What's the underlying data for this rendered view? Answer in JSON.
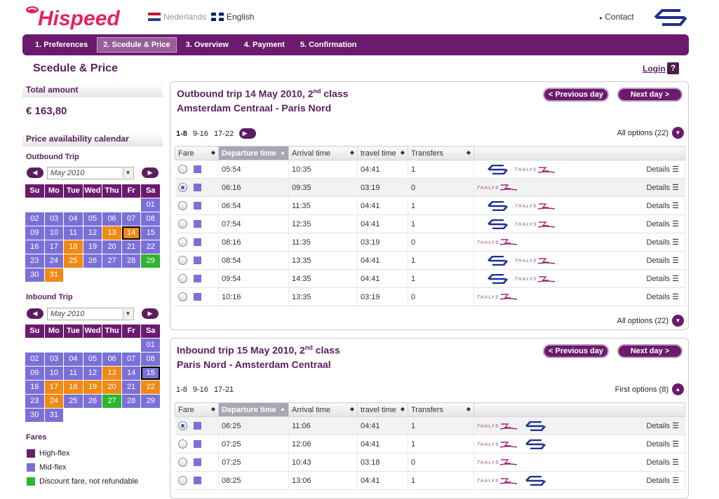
{
  "brand": "Hispeed",
  "languages": [
    {
      "label": "Nederlands",
      "active": false
    },
    {
      "label": "English",
      "active": true
    }
  ],
  "contact": "Contact",
  "steps": [
    "1. Preferences",
    "2. Scedule & Price",
    "3. Overview",
    "4. Payment",
    "5. Confirmation"
  ],
  "page_title": "Scedule & Price",
  "login": "Login",
  "help": "?",
  "sidebar": {
    "total_label": "Total amount",
    "total_value": "€ 163,80",
    "calendar_heading": "Price availability calendar",
    "outbound": {
      "title": "Outbound Trip",
      "month": "May 2010"
    },
    "inbound": {
      "title": "Inbound Trip",
      "month": "May 2010"
    },
    "weekdays": [
      "Su",
      "Mo",
      "Tue",
      "Wed",
      "Thu",
      "Fr",
      "Sa"
    ],
    "fares_title": "Fares",
    "fares_legend": [
      {
        "label": "High-flex",
        "color": "#6b1a6e"
      },
      {
        "label": "Mid-flex",
        "color": "#7b70d8"
      },
      {
        "label": "Discount fare, not refundable",
        "color": "#2db52d"
      }
    ]
  },
  "outbound_calendar": [
    [
      null,
      null,
      null,
      null,
      null,
      null,
      {
        "d": "01",
        "c": "m"
      }
    ],
    [
      {
        "d": "02",
        "c": "m"
      },
      {
        "d": "03",
        "c": "m"
      },
      {
        "d": "04",
        "c": "m"
      },
      {
        "d": "05",
        "c": "m"
      },
      {
        "d": "06",
        "c": "m"
      },
      {
        "d": "07",
        "c": "m"
      },
      {
        "d": "08",
        "c": "m"
      }
    ],
    [
      {
        "d": "09",
        "c": "m"
      },
      {
        "d": "10",
        "c": "m"
      },
      {
        "d": "11",
        "c": "m"
      },
      {
        "d": "12",
        "c": "m"
      },
      {
        "d": "13",
        "c": "o"
      },
      {
        "d": "14",
        "c": "o",
        "sel": true
      },
      {
        "d": "15",
        "c": "m"
      }
    ],
    [
      {
        "d": "16",
        "c": "m"
      },
      {
        "d": "17",
        "c": "m"
      },
      {
        "d": "18",
        "c": "o"
      },
      {
        "d": "19",
        "c": "m"
      },
      {
        "d": "20",
        "c": "m"
      },
      {
        "d": "21",
        "c": "m"
      },
      {
        "d": "22",
        "c": "m"
      }
    ],
    [
      {
        "d": "23",
        "c": "m"
      },
      {
        "d": "24",
        "c": "m"
      },
      {
        "d": "25",
        "c": "o"
      },
      {
        "d": "26",
        "c": "m"
      },
      {
        "d": "27",
        "c": "m"
      },
      {
        "d": "28",
        "c": "m"
      },
      {
        "d": "29",
        "c": "g"
      }
    ],
    [
      {
        "d": "30",
        "c": "m"
      },
      {
        "d": "31",
        "c": "o"
      },
      null,
      null,
      null,
      null,
      null
    ]
  ],
  "inbound_calendar": [
    [
      null,
      null,
      null,
      null,
      null,
      null,
      {
        "d": "01",
        "c": "m"
      }
    ],
    [
      {
        "d": "02",
        "c": "m"
      },
      {
        "d": "03",
        "c": "m"
      },
      {
        "d": "04",
        "c": "m"
      },
      {
        "d": "05",
        "c": "m"
      },
      {
        "d": "06",
        "c": "m"
      },
      {
        "d": "07",
        "c": "m"
      },
      {
        "d": "08",
        "c": "m"
      }
    ],
    [
      {
        "d": "09",
        "c": "m"
      },
      {
        "d": "10",
        "c": "m"
      },
      {
        "d": "11",
        "c": "m"
      },
      {
        "d": "12",
        "c": "m"
      },
      {
        "d": "13",
        "c": "o"
      },
      {
        "d": "14",
        "c": "m"
      },
      {
        "d": "15",
        "c": "m",
        "sel": true
      }
    ],
    [
      {
        "d": "16",
        "c": "m"
      },
      {
        "d": "17",
        "c": "o"
      },
      {
        "d": "18",
        "c": "o"
      },
      {
        "d": "19",
        "c": "o"
      },
      {
        "d": "20",
        "c": "o"
      },
      {
        "d": "21",
        "c": "m"
      },
      {
        "d": "22",
        "c": "o"
      }
    ],
    [
      {
        "d": "23",
        "c": "m"
      },
      {
        "d": "24",
        "c": "o"
      },
      {
        "d": "25",
        "c": "m"
      },
      {
        "d": "26",
        "c": "m"
      },
      {
        "d": "27",
        "c": "g"
      },
      {
        "d": "28",
        "c": "m"
      },
      {
        "d": "29",
        "c": "m"
      }
    ],
    [
      {
        "d": "30",
        "c": "m"
      },
      {
        "d": "31",
        "c": "m"
      },
      null,
      null,
      null,
      null,
      null
    ]
  ],
  "outbound": {
    "title_pre": "Outbound trip 14 May 2010, 2",
    "title_sup": "nd",
    "title_post": " class",
    "route": "Amsterdam Centraal - Paris Nord",
    "prev": "< Previous day",
    "next": "Next day >",
    "pages": [
      "1-8",
      "9-16",
      "17-22"
    ],
    "options_top": "All options (22)",
    "options_bottom": "All options (22)",
    "columns": [
      "Fare",
      "Departure time",
      "Arrival time",
      "travel time",
      "Transfers"
    ],
    "details_label": "Details",
    "rows": [
      {
        "dep": "05:54",
        "arr": "10:35",
        "travel": "04:41",
        "transfers": "1",
        "ops": [
          "ns",
          "thalys"
        ],
        "selected": false
      },
      {
        "dep": "06:16",
        "arr": "09:35",
        "travel": "03:19",
        "transfers": "0",
        "ops": [
          "thalys"
        ],
        "selected": true
      },
      {
        "dep": "06:54",
        "arr": "11:35",
        "travel": "04:41",
        "transfers": "1",
        "ops": [
          "ns",
          "thalys"
        ],
        "selected": false
      },
      {
        "dep": "07:54",
        "arr": "12:35",
        "travel": "04:41",
        "transfers": "1",
        "ops": [
          "ns",
          "thalys"
        ],
        "selected": false
      },
      {
        "dep": "08:16",
        "arr": "11:35",
        "travel": "03:19",
        "transfers": "0",
        "ops": [
          "thalys"
        ],
        "selected": false
      },
      {
        "dep": "08:54",
        "arr": "13:35",
        "travel": "04:41",
        "transfers": "1",
        "ops": [
          "ns",
          "thalys"
        ],
        "selected": false
      },
      {
        "dep": "09:54",
        "arr": "14:35",
        "travel": "04:41",
        "transfers": "1",
        "ops": [
          "ns",
          "thalys"
        ],
        "selected": false
      },
      {
        "dep": "10:16",
        "arr": "13:35",
        "travel": "03:19",
        "transfers": "0",
        "ops": [
          "thalys"
        ],
        "selected": false
      }
    ]
  },
  "inbound": {
    "title_pre": "Inbound trip 15 May 2010, 2",
    "title_sup": "nd",
    "title_post": " class",
    "route": "Paris Nord - Amsterdam Centraal",
    "prev": "< Previous day",
    "next": "Next day >",
    "pages": [
      "1-8",
      "9-16",
      "17-21"
    ],
    "options_top": "First options (8)",
    "columns": [
      "Fare",
      "Departure time",
      "Arrival time",
      "travel time",
      "Transfers"
    ],
    "details_label": "Details",
    "rows": [
      {
        "dep": "06:25",
        "arr": "11:06",
        "travel": "04:41",
        "transfers": "1",
        "ops": [
          "thalys",
          "ns"
        ],
        "selected": true
      },
      {
        "dep": "07:25",
        "arr": "12:06",
        "travel": "04:41",
        "transfers": "1",
        "ops": [
          "thalys",
          "ns"
        ],
        "selected": false
      },
      {
        "dep": "07:25",
        "arr": "10:43",
        "travel": "03:18",
        "transfers": "0",
        "ops": [
          "thalys"
        ],
        "selected": false
      },
      {
        "dep": "08:25",
        "arr": "13:06",
        "travel": "04:41",
        "transfers": "1",
        "ops": [
          "thalys",
          "ns"
        ],
        "selected": false
      }
    ]
  },
  "operators": {
    "thalys_text": "THALYS"
  },
  "colors": {
    "brand": "#6b1a6e",
    "mid": "#7b70d8",
    "orange": "#f08a15",
    "green": "#2db52d",
    "logo_red": "#e0245e"
  }
}
